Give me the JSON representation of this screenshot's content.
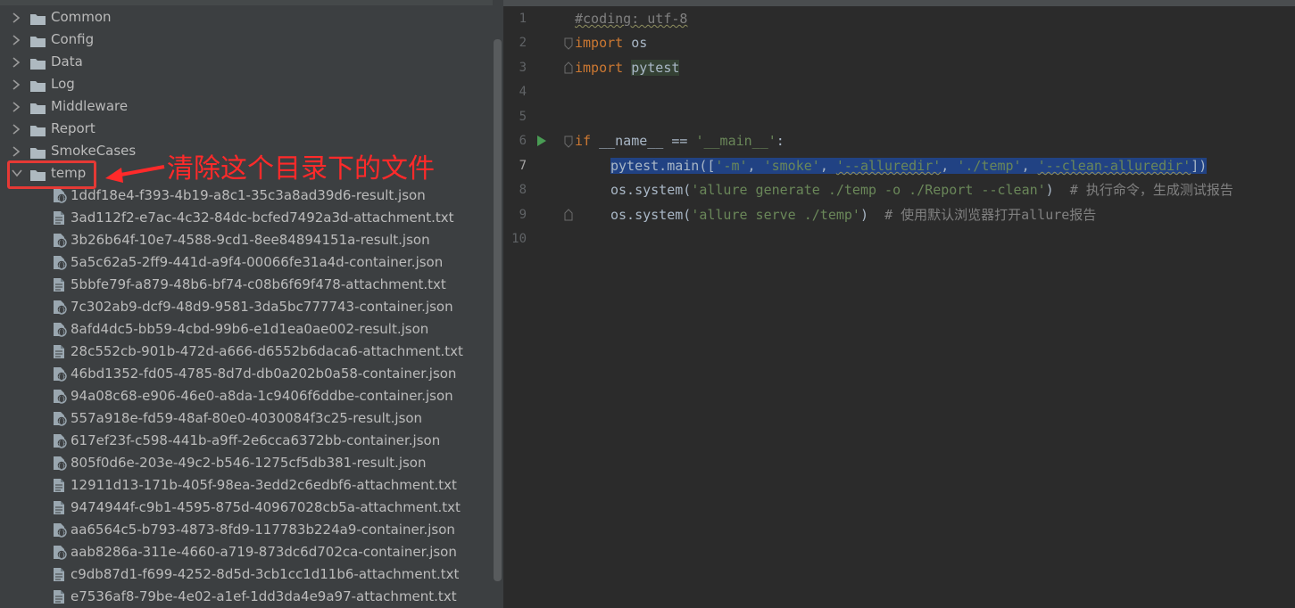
{
  "tree": {
    "folders": [
      {
        "label": "Common",
        "expanded": false
      },
      {
        "label": "Config",
        "expanded": false
      },
      {
        "label": "Data",
        "expanded": false
      },
      {
        "label": "Log",
        "expanded": false
      },
      {
        "label": "Middleware",
        "expanded": false
      },
      {
        "label": "Report",
        "expanded": false
      },
      {
        "label": "SmokeCases",
        "expanded": false
      },
      {
        "label": "temp",
        "expanded": true
      }
    ],
    "files": [
      {
        "name": "1ddf18e4-f393-4b19-a8c1-35c3a8ad39d6-result.json",
        "type": "json"
      },
      {
        "name": "3ad112f2-e7ac-4c32-84dc-bcfed7492a3d-attachment.txt",
        "type": "txt"
      },
      {
        "name": "3b26b64f-10e7-4588-9cd1-8ee84894151a-result.json",
        "type": "json"
      },
      {
        "name": "5a5c62a5-2ff9-441d-a9f4-00066fe31a4d-container.json",
        "type": "json"
      },
      {
        "name": "5bbfe79f-a879-48b6-bf74-c08b6f69f478-attachment.txt",
        "type": "txt"
      },
      {
        "name": "7c302ab9-dcf9-48d9-9581-3da5bc777743-container.json",
        "type": "json"
      },
      {
        "name": "8afd4dc5-bb59-4cbd-99b6-e1d1ea0ae002-result.json",
        "type": "json"
      },
      {
        "name": "28c552cb-901b-472d-a666-d6552b6daca6-attachment.txt",
        "type": "txt"
      },
      {
        "name": "46bd1352-fd05-4785-8d7d-db0a202b0a58-container.json",
        "type": "json"
      },
      {
        "name": "94a08c68-e906-46e0-a8da-1c9406f6ddbe-container.json",
        "type": "json"
      },
      {
        "name": "557a918e-fd59-48af-80e0-4030084f3c25-result.json",
        "type": "json"
      },
      {
        "name": "617ef23f-c598-441b-a9ff-2e6cca6372bb-container.json",
        "type": "json"
      },
      {
        "name": "805f0d6e-203e-49c2-b546-1275cf5db381-result.json",
        "type": "json"
      },
      {
        "name": "12911d13-171b-405f-98ea-3edd2c6edbf6-attachment.txt",
        "type": "txt"
      },
      {
        "name": "9474944f-c9b1-4595-875d-40967028cb5a-attachment.txt",
        "type": "txt"
      },
      {
        "name": "aa6564c5-b793-4873-8fd9-117783b224a9-container.json",
        "type": "json"
      },
      {
        "name": "aab8286a-311e-4660-a719-873dc6d702ca-container.json",
        "type": "json"
      },
      {
        "name": "c9db87d1-f699-4252-8d5d-3cb1cc1d11b6-attachment.txt",
        "type": "txt"
      },
      {
        "name": "e7536af8-79be-4e02-a1ef-1dd3da4e9a97-attachment.txt",
        "type": "txt"
      }
    ]
  },
  "annotation": {
    "text": "清除这个目录下的文件",
    "color": "#ff2a2a"
  },
  "editor": {
    "line_numbers": [
      "1",
      "2",
      "3",
      "4",
      "5",
      "6",
      "7",
      "8",
      "9",
      "10"
    ],
    "current_line": "7",
    "lines": {
      "l1": {
        "comment": "#coding: utf-8"
      },
      "l2": {
        "kw": "import",
        "name": "os"
      },
      "l3": {
        "kw": "import",
        "name": "pytest"
      },
      "l6": {
        "kw": "if",
        "cond": "__name__ == ",
        "str": "'__main__'",
        "tail": ":"
      },
      "l7": {
        "pre": "pytest.main([",
        "s1": "'-m'",
        "c1": ", ",
        "s2": "'smoke'",
        "c2": ", ",
        "s3": "'--alluredir'",
        "c3": ", ",
        "s4": "'./temp'",
        "c4": ", ",
        "s5": "'--clean-alluredir'",
        "post": "])"
      },
      "l8": {
        "pre": "os.system(",
        "str": "'allure generate ./temp -o ./Report --clean'",
        "post": ")",
        "comment": "# 执行命令，生成测试报告"
      },
      "l9": {
        "pre": "os.system(",
        "str": "'allure serve ./temp'",
        "post": ")",
        "comment": "# 使用默认浏览器打开allure报告"
      }
    }
  },
  "colors": {
    "tree_bg": "#3c3f41",
    "editor_bg": "#2b2b2b",
    "keyword": "#cc7832",
    "string": "#6a8759",
    "comment": "#808080",
    "selection": "#214283",
    "run_icon": "#499c54"
  }
}
